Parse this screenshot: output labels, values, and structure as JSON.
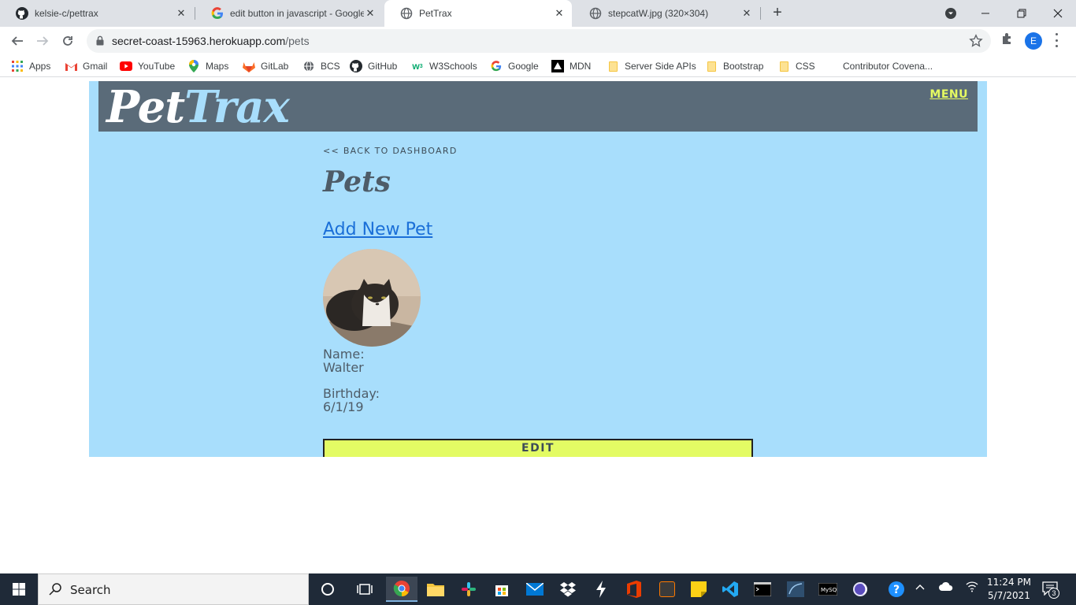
{
  "browser": {
    "tabs": [
      {
        "title": "kelsie-c/pettrax",
        "icon": "github-icon"
      },
      {
        "title": "edit button in javascript - Google",
        "icon": "google-icon"
      },
      {
        "title": "PetTrax",
        "icon": "globe-icon"
      },
      {
        "title": "stepcatW.jpg (320×304)",
        "icon": "globe-icon"
      }
    ],
    "url_host": "secret-coast-15963.herokuapp.com",
    "url_path": "/pets",
    "profile_initial": "E",
    "bookmarks": [
      {
        "label": "Apps"
      },
      {
        "label": "Gmail"
      },
      {
        "label": "YouTube"
      },
      {
        "label": "Maps"
      },
      {
        "label": "GitLab"
      },
      {
        "label": "BCS"
      },
      {
        "label": "GitHub"
      },
      {
        "label": "W3Schools"
      },
      {
        "label": "Google"
      },
      {
        "label": "MDN"
      },
      {
        "label": "Server Side APIs"
      },
      {
        "label": "Bootstrap"
      },
      {
        "label": "CSS"
      },
      {
        "label": "Contributor Covena..."
      }
    ]
  },
  "site": {
    "logo_pet": "Pet",
    "logo_trax": "Trax",
    "menu_label": "MENU",
    "back_link": "<< BACK TO DASHBOARD",
    "page_title": "Pets",
    "add_pet_link": "Add New Pet",
    "pet": {
      "name_label": "Name:",
      "name": "Walter",
      "birthday_label": "Birthday:",
      "birthday": "6/1/19"
    },
    "edit_button": "EDIT"
  },
  "taskbar": {
    "search_placeholder": "Search",
    "time": "11:24 PM",
    "date": "5/7/2021",
    "notification_count": "3"
  },
  "colors": {
    "page_background": "#a8defc",
    "header_background": "#5a6b79",
    "accent_yellow": "#e3fb64",
    "link_blue": "#1a6fd8"
  }
}
